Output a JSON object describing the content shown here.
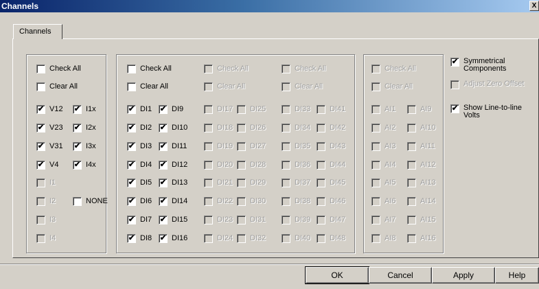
{
  "window": {
    "title": "Channels",
    "close_glyph": "X"
  },
  "tab": {
    "label": "Channels"
  },
  "groups": [
    {
      "cols": [
        {
          "header": [
            {
              "label": "Check All",
              "checked": false,
              "enabled": true
            },
            {
              "label": "Clear All",
              "checked": false,
              "enabled": true
            }
          ],
          "items": [
            {
              "label": "V12",
              "checked": true,
              "enabled": true
            },
            {
              "label": "V23",
              "checked": true,
              "enabled": true
            },
            {
              "label": "V31",
              "checked": true,
              "enabled": true
            },
            {
              "label": "V4",
              "checked": true,
              "enabled": true
            },
            {
              "label": "I1",
              "checked": false,
              "enabled": false
            },
            {
              "label": "I2",
              "checked": false,
              "enabled": false
            },
            {
              "label": "I3",
              "checked": false,
              "enabled": false
            },
            {
              "label": "I4",
              "checked": false,
              "enabled": false
            }
          ]
        },
        {
          "header": [],
          "items": [
            {
              "label": "I1x",
              "checked": true,
              "enabled": true
            },
            {
              "label": "I2x",
              "checked": true,
              "enabled": true
            },
            {
              "label": "I3x",
              "checked": true,
              "enabled": true
            },
            {
              "label": "I4x",
              "checked": true,
              "enabled": true
            },
            null,
            {
              "label": "NONE",
              "checked": false,
              "enabled": true
            },
            null,
            null
          ]
        }
      ]
    },
    {
      "cols": [
        {
          "header": [
            {
              "label": "Check All",
              "checked": false,
              "enabled": true
            },
            {
              "label": "Clear All",
              "checked": false,
              "enabled": true
            }
          ],
          "items": [
            {
              "label": "DI1",
              "checked": true,
              "enabled": true
            },
            {
              "label": "DI2",
              "checked": true,
              "enabled": true
            },
            {
              "label": "DI3",
              "checked": true,
              "enabled": true
            },
            {
              "label": "DI4",
              "checked": true,
              "enabled": true
            },
            {
              "label": "DI5",
              "checked": true,
              "enabled": true
            },
            {
              "label": "DI6",
              "checked": true,
              "enabled": true
            },
            {
              "label": "DI7",
              "checked": true,
              "enabled": true
            },
            {
              "label": "DI8",
              "checked": true,
              "enabled": true
            }
          ]
        },
        {
          "header": [],
          "items": [
            {
              "label": "DI9",
              "checked": true,
              "enabled": true
            },
            {
              "label": "DI10",
              "checked": true,
              "enabled": true
            },
            {
              "label": "DI11",
              "checked": true,
              "enabled": true
            },
            {
              "label": "DI12",
              "checked": true,
              "enabled": true
            },
            {
              "label": "DI13",
              "checked": true,
              "enabled": true
            },
            {
              "label": "DI14",
              "checked": true,
              "enabled": true
            },
            {
              "label": "DI15",
              "checked": true,
              "enabled": true
            },
            {
              "label": "DI16",
              "checked": true,
              "enabled": true
            }
          ]
        },
        {
          "header": [
            {
              "label": "Check All",
              "checked": false,
              "enabled": false
            },
            {
              "label": "Clear All",
              "checked": false,
              "enabled": false
            }
          ],
          "items": [
            {
              "label": "DI17",
              "checked": false,
              "enabled": false
            },
            {
              "label": "DI18",
              "checked": false,
              "enabled": false
            },
            {
              "label": "DI19",
              "checked": false,
              "enabled": false
            },
            {
              "label": "DI20",
              "checked": false,
              "enabled": false
            },
            {
              "label": "DI21",
              "checked": false,
              "enabled": false
            },
            {
              "label": "DI22",
              "checked": false,
              "enabled": false
            },
            {
              "label": "DI23",
              "checked": false,
              "enabled": false
            },
            {
              "label": "DI24",
              "checked": false,
              "enabled": false
            }
          ]
        },
        {
          "header": [],
          "items": [
            {
              "label": "DI25",
              "checked": false,
              "enabled": false
            },
            {
              "label": "DI26",
              "checked": false,
              "enabled": false
            },
            {
              "label": "DI27",
              "checked": false,
              "enabled": false
            },
            {
              "label": "DI28",
              "checked": false,
              "enabled": false
            },
            {
              "label": "DI29",
              "checked": false,
              "enabled": false
            },
            {
              "label": "DI30",
              "checked": false,
              "enabled": false
            },
            {
              "label": "DI31",
              "checked": false,
              "enabled": false
            },
            {
              "label": "DI32",
              "checked": false,
              "enabled": false
            }
          ]
        },
        {
          "header": [
            {
              "label": "Check All",
              "checked": false,
              "enabled": false
            },
            {
              "label": "Clear All",
              "checked": false,
              "enabled": false
            }
          ],
          "items": [
            {
              "label": "DI33",
              "checked": false,
              "enabled": false
            },
            {
              "label": "DI34",
              "checked": false,
              "enabled": false
            },
            {
              "label": "DI35",
              "checked": false,
              "enabled": false
            },
            {
              "label": "DI36",
              "checked": false,
              "enabled": false
            },
            {
              "label": "DI37",
              "checked": false,
              "enabled": false
            },
            {
              "label": "DI38",
              "checked": false,
              "enabled": false
            },
            {
              "label": "DI39",
              "checked": false,
              "enabled": false
            },
            {
              "label": "DI40",
              "checked": false,
              "enabled": false
            }
          ]
        },
        {
          "header": [],
          "items": [
            {
              "label": "DI41",
              "checked": false,
              "enabled": false
            },
            {
              "label": "DI42",
              "checked": false,
              "enabled": false
            },
            {
              "label": "DI43",
              "checked": false,
              "enabled": false
            },
            {
              "label": "DI44",
              "checked": false,
              "enabled": false
            },
            {
              "label": "DI45",
              "checked": false,
              "enabled": false
            },
            {
              "label": "DI46",
              "checked": false,
              "enabled": false
            },
            {
              "label": "DI47",
              "checked": false,
              "enabled": false
            },
            {
              "label": "DI48",
              "checked": false,
              "enabled": false
            }
          ]
        }
      ]
    },
    {
      "cols": [
        {
          "header": [
            {
              "label": "Check All",
              "checked": false,
              "enabled": false
            },
            {
              "label": "Clear All",
              "checked": false,
              "enabled": false
            }
          ],
          "items": [
            {
              "label": "AI1",
              "checked": false,
              "enabled": false
            },
            {
              "label": "AI2",
              "checked": false,
              "enabled": false
            },
            {
              "label": "AI3",
              "checked": false,
              "enabled": false
            },
            {
              "label": "AI4",
              "checked": false,
              "enabled": false
            },
            {
              "label": "AI5",
              "checked": false,
              "enabled": false
            },
            {
              "label": "AI6",
              "checked": false,
              "enabled": false
            },
            {
              "label": "AI7",
              "checked": false,
              "enabled": false
            },
            {
              "label": "AI8",
              "checked": false,
              "enabled": false
            }
          ]
        },
        {
          "header": [],
          "items": [
            {
              "label": "AI9",
              "checked": false,
              "enabled": false
            },
            {
              "label": "AI10",
              "checked": false,
              "enabled": false
            },
            {
              "label": "AI11",
              "checked": false,
              "enabled": false
            },
            {
              "label": "AI12",
              "checked": false,
              "enabled": false
            },
            {
              "label": "AI13",
              "checked": false,
              "enabled": false
            },
            {
              "label": "AI14",
              "checked": false,
              "enabled": false
            },
            {
              "label": "AI15",
              "checked": false,
              "enabled": false
            },
            {
              "label": "AI16",
              "checked": false,
              "enabled": false
            }
          ]
        }
      ]
    }
  ],
  "options": [
    {
      "label": "Symmetrical Components",
      "checked": true,
      "enabled": true
    },
    {
      "label": "Adjust Zero Offset",
      "checked": false,
      "enabled": false
    },
    {
      "label": "Show Line-to-line Volts",
      "checked": true,
      "enabled": true
    }
  ],
  "buttons": {
    "ok": "OK",
    "cancel": "Cancel",
    "apply": "Apply",
    "help": "Help"
  },
  "check_glyph": "✔"
}
